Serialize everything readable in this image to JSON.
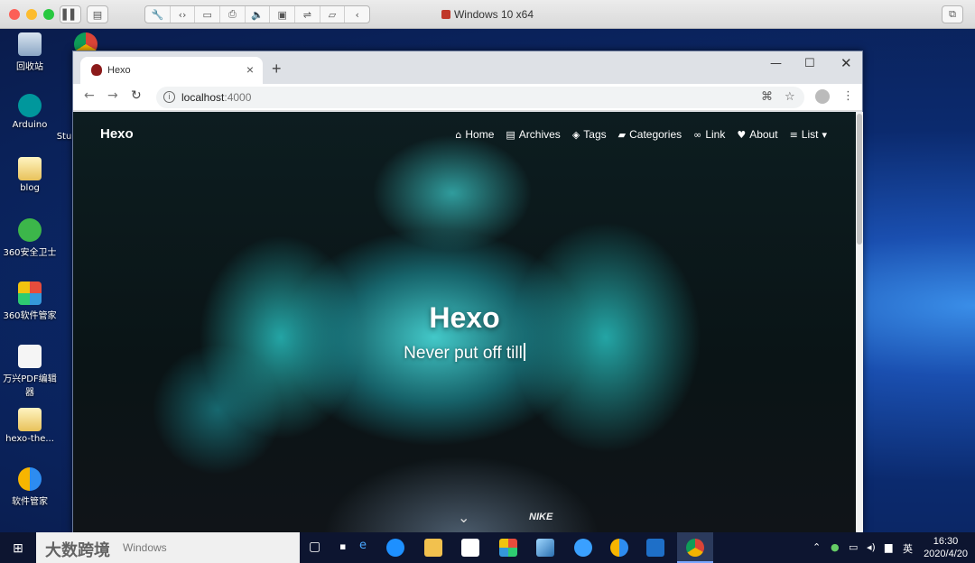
{
  "vm": {
    "title": "Windows 10 x64",
    "icons": [
      "pause-icon",
      "snapshot-icon",
      "wrench-icon",
      "code-icon",
      "drive-icon",
      "printer-icon",
      "sound-icon",
      "camera-icon",
      "usb-icon",
      "folder-share-icon",
      "chevron-left-icon"
    ]
  },
  "desktop_icons": [
    {
      "label": "回收站",
      "icon": "recycle-bin-icon"
    },
    {
      "label": "Arduino",
      "icon": "arduino-icon"
    },
    {
      "label": "blog",
      "icon": "folder-icon"
    },
    {
      "label": "360安全卫士",
      "icon": "360-security-icon"
    },
    {
      "label": "360软件管家",
      "icon": "360-software-icon"
    },
    {
      "label": "万兴PDF编辑器",
      "icon": "pdf-editor-icon"
    },
    {
      "label": "hexo-the...",
      "icon": "folder-icon"
    },
    {
      "label": "软件管家",
      "icon": "software-manager-icon"
    },
    {
      "label": "Stu",
      "icon": "partial-label"
    }
  ],
  "browser": {
    "tab_title": "Hexo",
    "url_host": "localhost",
    "url_port": ":4000"
  },
  "page": {
    "brand": "Hexo",
    "nav": [
      {
        "label": "Home",
        "icon": "home-icon"
      },
      {
        "label": "Archives",
        "icon": "archive-icon"
      },
      {
        "label": "Tags",
        "icon": "tags-icon"
      },
      {
        "label": "Categories",
        "icon": "folder-open-icon"
      },
      {
        "label": "Link",
        "icon": "link-icon"
      },
      {
        "label": "About",
        "icon": "heart-icon"
      },
      {
        "label": "List",
        "icon": "list-icon"
      }
    ],
    "hero_title": "Hexo",
    "hero_subtitle": "Never put off till",
    "shirt_logo": "NIKE"
  },
  "taskbar": {
    "search_placeholder": "Windows",
    "watermark": "大数跨境",
    "tray_lang": "英",
    "time": "16:30",
    "date": "2020/4/20"
  }
}
